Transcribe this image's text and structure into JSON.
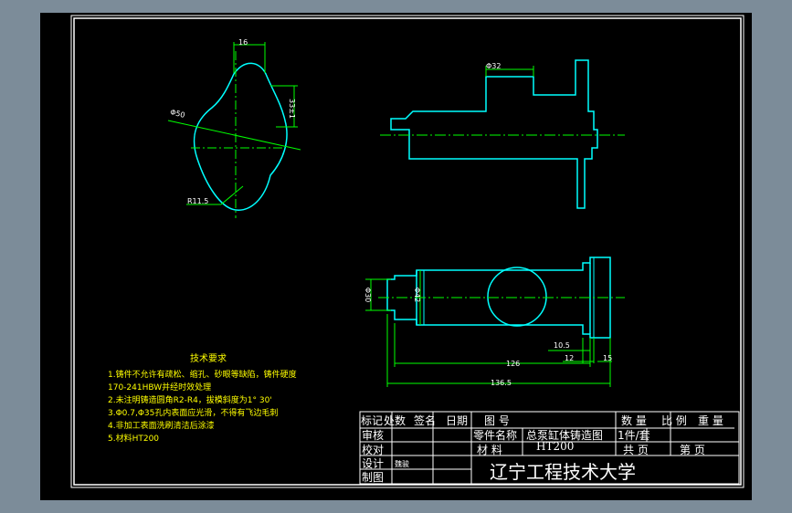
{
  "colors": {
    "background": "#7c8c99",
    "sheet": "#000000",
    "outline": "#00ffff",
    "centerline": "#00ff00",
    "dimension": "#00ff00",
    "text": "#ffff00",
    "title_block": "#ffffff"
  },
  "drawing": {
    "dimensions": {
      "top_width": "16",
      "diameter": "Φ50",
      "height_right": "33±1",
      "radius": "R11.5",
      "flange_width": "Φ32",
      "left_dia": "Φ30",
      "inner_dia": "Φ42",
      "len_126": "126",
      "len_136": "136.5",
      "d_10_5": "10.5",
      "d_12": "12",
      "d_15": "15"
    },
    "technical_requirements": {
      "title": "技术要求",
      "items": [
        "1.铸件不允许有疏松、缩孔、砂眼等缺陷，铸件硬度",
        "170-241HBW并经时效处理",
        "2.未注明铸造圆角R2-R4，拔模斜度为1° 30'",
        "3.Φ0.7,Φ35孔内表面应光滑，不得有飞边毛刺",
        "4.非加工表面洗刷清洁后涂漆",
        "5.材料HT200"
      ]
    }
  },
  "title_block": {
    "rev_headers": [
      "标记",
      "处数",
      "签名",
      "日期"
    ],
    "review": "审核",
    "check": "校对",
    "design": "设计",
    "draw": "制图",
    "designer_sig": "魏骏",
    "drawing_no": "图 号",
    "part_name_label": "零件名称",
    "part_name": "总泵缸体铸造图",
    "material_label": "材 料",
    "material": "HT200",
    "quantity_label": "数 量",
    "scale_label": "比 例",
    "weight_label": "重 量",
    "quantity": "1件/套",
    "total_pages": "共 页",
    "page_no": "第 页",
    "school": "辽宁工程技术大学"
  }
}
